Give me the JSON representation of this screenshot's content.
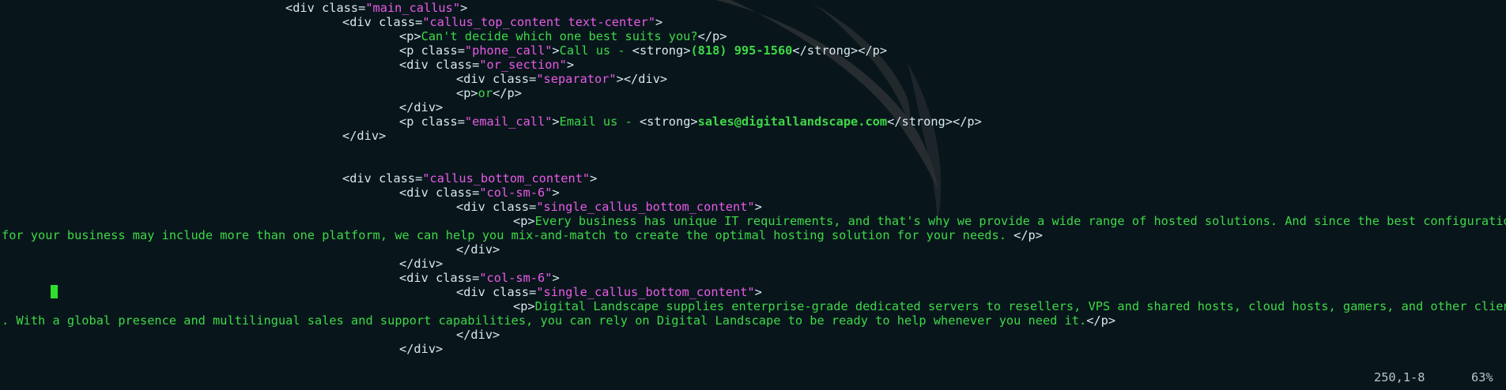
{
  "editor": {
    "lines": [
      {
        "id": "l1",
        "parts": [
          [
            "tag",
            "<div "
          ],
          [
            "attr",
            "class="
          ],
          [
            "str",
            "\"main_callus\""
          ],
          [
            "tag",
            ">"
          ]
        ]
      },
      {
        "id": "l2",
        "parts": [
          [
            "tag",
            "<div "
          ],
          [
            "attr",
            "class="
          ],
          [
            "str",
            "\"callus_top_content text-center\""
          ],
          [
            "tag",
            ">"
          ]
        ]
      },
      {
        "id": "l3",
        "parts": [
          [
            "tag",
            "<p>"
          ],
          [
            "txt",
            "Can't decide which one best suits you?"
          ],
          [
            "tag",
            "</p>"
          ]
        ]
      },
      {
        "id": "l4",
        "parts": [
          [
            "tag",
            "<p "
          ],
          [
            "attr",
            "class="
          ],
          [
            "str",
            "\"phone_call\""
          ],
          [
            "tag",
            ">"
          ],
          [
            "txt",
            "Call us - "
          ],
          [
            "tag",
            "<strong>"
          ],
          [
            "bold",
            "(818) 995-1560"
          ],
          [
            "tag",
            "</strong></p>"
          ]
        ]
      },
      {
        "id": "l5",
        "parts": [
          [
            "tag",
            "<div "
          ],
          [
            "attr",
            "class="
          ],
          [
            "str",
            "\"or_section\""
          ],
          [
            "tag",
            ">"
          ]
        ]
      },
      {
        "id": "l6",
        "parts": [
          [
            "tag",
            "<div "
          ],
          [
            "attr",
            "class="
          ],
          [
            "str",
            "\"separator\""
          ],
          [
            "tag",
            "></div>"
          ]
        ]
      },
      {
        "id": "l7",
        "parts": [
          [
            "tag",
            "<p>"
          ],
          [
            "txt",
            "or"
          ],
          [
            "tag",
            "</p>"
          ]
        ]
      },
      {
        "id": "l8",
        "parts": [
          [
            "tag",
            "</div>"
          ]
        ]
      },
      {
        "id": "l9",
        "parts": [
          [
            "tag",
            "<p "
          ],
          [
            "attr",
            "class="
          ],
          [
            "str",
            "\"email_call\""
          ],
          [
            "tag",
            ">"
          ],
          [
            "txt",
            "Email us - "
          ],
          [
            "tag",
            "<strong>"
          ],
          [
            "bold",
            "sales@digitallandscape.com"
          ],
          [
            "tag",
            "</strong></p>"
          ]
        ]
      },
      {
        "id": "l10",
        "parts": [
          [
            "tag",
            "</div>"
          ]
        ]
      },
      {
        "id": "l11",
        "parts": [
          [
            "tag",
            "<div "
          ],
          [
            "attr",
            "class="
          ],
          [
            "str",
            "\"callus_bottom_content\""
          ],
          [
            "tag",
            ">"
          ]
        ]
      },
      {
        "id": "l12",
        "parts": [
          [
            "tag",
            "<div "
          ],
          [
            "attr",
            "class="
          ],
          [
            "str",
            "\"col-sm-6\""
          ],
          [
            "tag",
            ">"
          ]
        ]
      },
      {
        "id": "l13",
        "parts": [
          [
            "tag",
            "<div "
          ],
          [
            "attr",
            "class="
          ],
          [
            "str",
            "\"single_callus_bottom_content\""
          ],
          [
            "tag",
            ">"
          ]
        ]
      },
      {
        "id": "l14",
        "parts": [
          [
            "tag",
            "<p>"
          ],
          [
            "txt",
            "Every business has unique IT requirements, and that's why we provide a wide range of hosted solutions. And since the best configuration"
          ]
        ]
      },
      {
        "id": "l15",
        "parts": [
          [
            "txt",
            "for your business may include more than one platform, we can help you mix-and-match to create the optimal hosting solution for your needs. "
          ],
          [
            "tag",
            "</p>"
          ]
        ]
      },
      {
        "id": "l16",
        "parts": [
          [
            "tag",
            "</div>"
          ]
        ]
      },
      {
        "id": "l17",
        "parts": [
          [
            "tag",
            "</div>"
          ]
        ]
      },
      {
        "id": "l18",
        "parts": [
          [
            "tag",
            "<div "
          ],
          [
            "attr",
            "class="
          ],
          [
            "str",
            "\"col-sm-6\""
          ],
          [
            "tag",
            ">"
          ]
        ]
      },
      {
        "id": "l19",
        "parts": [
          [
            "tag",
            "<div "
          ],
          [
            "attr",
            "class="
          ],
          [
            "str",
            "\"single_callus_bottom_content\""
          ],
          [
            "tag",
            ">"
          ]
        ]
      },
      {
        "id": "l20",
        "parts": [
          [
            "tag",
            "<p>"
          ],
          [
            "txt",
            "Digital Landscape supplies enterprise-grade dedicated servers to resellers, VPS and shared hosts, cloud hosts, gamers, and other clients"
          ]
        ]
      },
      {
        "id": "l21",
        "parts": [
          [
            "txt",
            ". With a global presence and multilingual sales and support capabilities, you can rely on Digital Landscape to be ready to help whenever you need it."
          ],
          [
            "tag",
            "</p>"
          ]
        ]
      },
      {
        "id": "l22",
        "parts": [
          [
            "tag",
            "</div>"
          ]
        ]
      },
      {
        "id": "l23",
        "parts": [
          [
            "tag",
            "</div>"
          ]
        ]
      }
    ]
  },
  "status": {
    "position": "250,1-8",
    "scroll_percent": "63%"
  },
  "colors": {
    "background": "#08161c",
    "tag": "#d8e8ee",
    "string": "#ea5ae6",
    "text": "#3fd846",
    "cursor": "#2ee02e"
  }
}
